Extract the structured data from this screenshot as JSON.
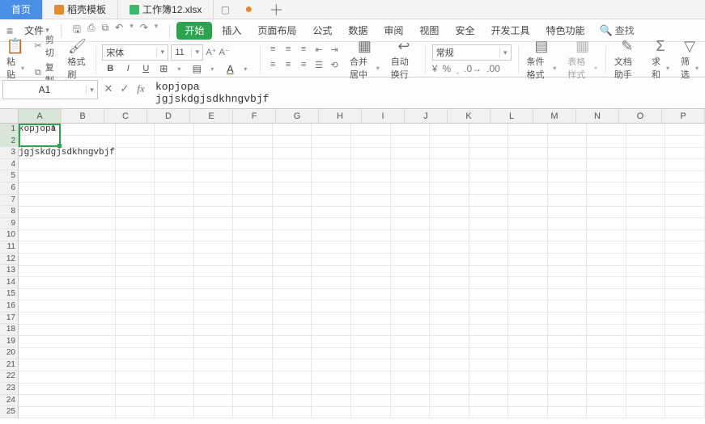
{
  "tabs": [
    {
      "label": "首页"
    },
    {
      "label": "稻壳模板"
    },
    {
      "label": "工作簿12.xlsx"
    }
  ],
  "new_tab": "＋",
  "title_pin": "▢",
  "title_dot": "●",
  "menu": {
    "file": "文件",
    "hamburger": "≡"
  },
  "quick_icons": {
    "save": "🖫",
    "print": "⎙",
    "preview": "⧉",
    "undo": "↶",
    "redo": "↷"
  },
  "ribbon_tabs": [
    "开始",
    "插入",
    "页面布局",
    "公式",
    "数据",
    "审阅",
    "视图",
    "安全",
    "开发工具",
    "特色功能"
  ],
  "find_label": "查找",
  "toolbar": {
    "paste": "粘贴",
    "cut": "剪切",
    "copy": "复制",
    "fmtpaint": "格式刷",
    "font_name": "宋体",
    "font_size": "11",
    "merge_center": "合并居中",
    "wrap": "自动换行",
    "num_format": "常规",
    "cond_fmt": "条件格式",
    "table_fmt": "表格样式",
    "doc_assist": "文档助手",
    "sum": "求和",
    "filter": "筛选"
  },
  "formula": {
    "name_box": "A1",
    "text_line1": "kopjopa",
    "text_line2": "jgjskdgjsdkhngvbjf"
  },
  "columns": [
    "A",
    "B",
    "C",
    "D",
    "E",
    "F",
    "G",
    "H",
    "I",
    "J",
    "K",
    "L",
    "M",
    "N",
    "O",
    "P"
  ],
  "row_count": 25,
  "cells": {
    "A1": "kopjopa",
    "A2": "",
    "A3": "jgjskdgjsdkhngvbjf"
  },
  "caret_glyph": "I"
}
